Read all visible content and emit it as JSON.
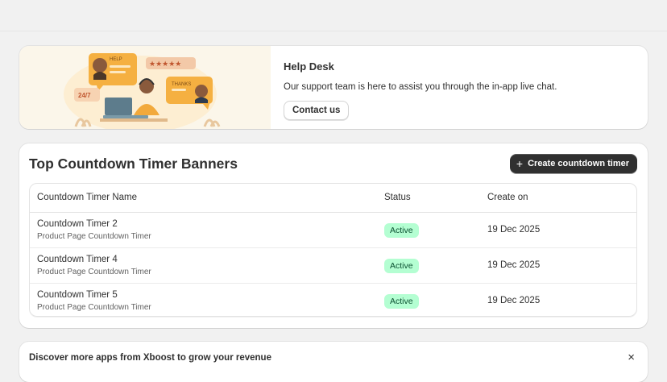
{
  "help_desk": {
    "title": "Help Desk",
    "description": "Our support team is here to assist you through the in-app live chat.",
    "contact_label": "Contact us",
    "illustration_text": {
      "bubble_help": "HELP",
      "bubble_thanks": "THANKS",
      "badge_247": "24/7",
      "rating": "★★★★★"
    }
  },
  "timers": {
    "title": "Top Countdown Timer Banners",
    "create_label": "Create countdown timer",
    "create_icon": "plus-icon",
    "columns": {
      "name": "Countdown Timer Name",
      "status": "Status",
      "created": "Create on"
    },
    "rows": [
      {
        "name": "Countdown Timer 2",
        "type": "Product Page Countdown Timer",
        "status": "Active",
        "date": "19 Dec 2025"
      },
      {
        "name": "Countdown Timer 4",
        "type": "Product Page Countdown Timer",
        "status": "Active",
        "date": "19 Dec 2025"
      },
      {
        "name": "Countdown Timer 5",
        "type": "Product Page Countdown Timer",
        "status": "Active",
        "date": "19 Dec 2025"
      }
    ]
  },
  "discover": {
    "text": "Discover more apps from Xboost to grow your revenue",
    "close_symbol": "×"
  },
  "colors": {
    "page_bg": "#f1f1f1",
    "primary_button": "#303030",
    "badge_bg": "#b4fed2",
    "badge_text": "#0c5132",
    "illustration_bg": "#fbf6ea",
    "accent_orange": "#f5b041"
  }
}
